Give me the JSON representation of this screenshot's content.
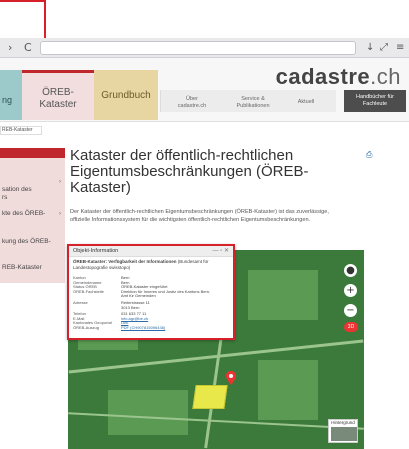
{
  "browser": {
    "back": "›",
    "reload": "C",
    "download_icon": "↓",
    "expand_icon": "⤢",
    "menu_icon": "≡"
  },
  "header": {
    "tab_left_label": "ng",
    "tab_oereb_label": "ÖREB-\nKataster",
    "tab_grundbuch_label": "Grundbuch",
    "logo_main": "cadastre",
    "logo_suffix": ".ch",
    "nav": [
      {
        "label": "Über\ncadastre.ch"
      },
      {
        "label": "Service &\nPublikationen"
      },
      {
        "label": "Aktuell"
      }
    ],
    "handbuch_label": "Handbücher für\nFachleute"
  },
  "breadcrumb": "REB-Kataster",
  "sidebar": {
    "items": [
      {
        "label": "",
        "active": true
      },
      {
        "label": "sation des\nrs",
        "arrow": "›"
      },
      {
        "label": "kte des ÖREB-",
        "arrow": "›"
      },
      {
        "label": "kung des ÖREB-"
      },
      {
        "label": "REB-Kataster"
      }
    ]
  },
  "main": {
    "title": "Kataster der öffentlich-rechtlichen Eigentumsbeschränkungen (ÖREB-Kataster)",
    "intro": "Der Kataster der öffentlich-rechtlichen Eigentumsbeschränkungen (ÖREB-Kataster) ist das zuverlässige, offizielle Informationssystem für die wichtigsten öffentlich-rechtlichen Eigentumsbeschränkungen."
  },
  "popup": {
    "title": "Objekt-Information",
    "controls": "— ▫ ✕",
    "subtitle_bold": "ÖREB-Kataster: Verfügbarkeit der Informationen",
    "subtitle_rest": " (Bundesamt für Landestopografie swisstopo)",
    "rows": [
      {
        "label": "Kanton",
        "value": "Bern"
      },
      {
        "label": "Gemeindename",
        "value": "Bern"
      },
      {
        "label": "Status ÖREB",
        "value": "ÖREB-Kataster eingeführt"
      },
      {
        "label": "ÖREB-Fachstelle",
        "value": "Direktion für Inneres und Justiz des Kantons Bern,"
      },
      {
        "label": "",
        "value": "Amt für Gemeinden"
      },
      {
        "label": "Adresse",
        "value": "Reiterstrasse 11"
      },
      {
        "label": "",
        "value": "3013 Bern"
      },
      {
        "label": "Telefon",
        "value": "031 633 77 11"
      },
      {
        "label": "E-Mail",
        "value": "info.agr@be.ch",
        "link": true
      },
      {
        "label": "Kantonales Geoportal",
        "value": "Link",
        "link": true
      },
      {
        "label": "ÖREB-Auszug",
        "value": "PDF (CH907815096436)",
        "link": true
      }
    ]
  },
  "map": {
    "zoom_in": "+",
    "zoom_out": "−",
    "locate": "●",
    "badge": "3D",
    "background_label": "Hintergrund"
  },
  "colors": {
    "accent_red": "#c0272d",
    "popup_border": "#d6202a",
    "map_green": "#3b7a3a",
    "parcel_yellow": "#e8e84a"
  }
}
